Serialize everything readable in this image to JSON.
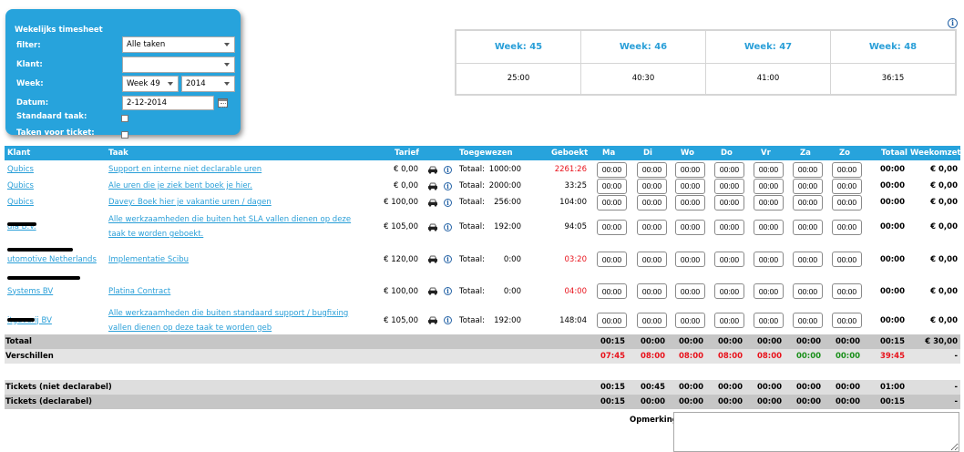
{
  "filter_panel": {
    "title": "Wekelijks timesheet",
    "filter_label": "filter:",
    "filter_value": "Alle taken",
    "klant_label": "Klant:",
    "klant_value": "",
    "week_label": "Week:",
    "week_value": "Week 49",
    "year_value": "2014",
    "datum_label": "Datum:",
    "datum_value": "2-12-2014",
    "standaard_label": "Standaard taak:",
    "tickets_label": "Taken voor ticket:"
  },
  "weeks": [
    {
      "label": "Week: 45",
      "value": "25:00"
    },
    {
      "label": "Week: 46",
      "value": "40:30"
    },
    {
      "label": "Week: 47",
      "value": "41:00"
    },
    {
      "label": "Week: 48",
      "value": "36:15"
    }
  ],
  "table": {
    "headers": {
      "klant": "Klant",
      "taak": "Taak",
      "tarief": "Tarief",
      "toegewezen": "Toegewezen",
      "geboekt": "Geboekt",
      "ma": "Ma",
      "di": "Di",
      "wo": "Wo",
      "do": "Do",
      "vr": "Vr",
      "za": "Za",
      "zo": "Zo",
      "totaal": "Totaal",
      "weekomzet": "Weekomzet"
    },
    "totaal_prefix": "Totaal:",
    "rows": [
      {
        "klant": "Qubics",
        "taak": "Support en interne niet declarable uren",
        "tarief": "€ 0,00",
        "toegewezen": "1000:00",
        "geboekt": "2261:26",
        "geboekt_status": "over",
        "days": [
          "00:00",
          "00:00",
          "00:00",
          "00:00",
          "00:00",
          "00:00",
          "00:00"
        ],
        "totaal": "00:00",
        "weekomzet": "€ 0,00"
      },
      {
        "klant": "Qubics",
        "taak": "Ale uren die je ziek bent boek je hier.",
        "tarief": "€ 0,00",
        "toegewezen": "2000:00",
        "geboekt": "33:25",
        "geboekt_status": "ok",
        "days": [
          "00:00",
          "00:00",
          "00:00",
          "00:00",
          "00:00",
          "00:00",
          "00:00"
        ],
        "totaal": "00:00",
        "weekomzet": "€ 0,00"
      },
      {
        "klant": "Qubics",
        "taak": "Davey: Boek hier je vakantie uren / dagen",
        "tarief": "€ 100,00",
        "toegewezen": "256:00",
        "geboekt": "104:00",
        "geboekt_status": "ok",
        "days": [
          "00:00",
          "00:00",
          "00:00",
          "00:00",
          "00:00",
          "00:00",
          "00:00"
        ],
        "totaal": "00:00",
        "weekomzet": "€ 0,00"
      },
      {
        "klant": "dia B.V.",
        "taak": "Alle werkzaamheden die buiten het SLA vallen dienen op deze taak te worden geboekt.",
        "tarief": "€ 105,00",
        "toegewezen": "192:00",
        "geboekt": "94:05",
        "geboekt_status": "ok",
        "days": [
          "00:00",
          "00:00",
          "00:00",
          "00:00",
          "00:00",
          "00:00",
          "00:00"
        ],
        "totaal": "00:00",
        "weekomzet": "€ 0,00"
      },
      {
        "klant": "utomotive Netherlands",
        "taak": "Implementatie Scibu",
        "tarief": "€ 120,00",
        "toegewezen": "0:00",
        "geboekt": "03:20",
        "geboekt_status": "over",
        "days": [
          "00:00",
          "00:00",
          "00:00",
          "00:00",
          "00:00",
          "00:00",
          "00:00"
        ],
        "totaal": "00:00",
        "weekomzet": "€ 0,00"
      },
      {
        "klant": "Systems BV",
        "taak": "Platina Contract",
        "tarief": "€ 100,00",
        "toegewezen": "0:00",
        "geboekt": "04:00",
        "geboekt_status": "over",
        "days": [
          "00:00",
          "00:00",
          "00:00",
          "00:00",
          "00:00",
          "00:00",
          "00:00"
        ],
        "totaal": "00:00",
        "weekomzet": "€ 0,00"
      },
      {
        "klant": "itgeverij BV",
        "taak": "Alle werkzaamheden die buiten standaard support / bugfixing vallen dienen op deze taak te worden geb",
        "tarief": "€ 105,00",
        "toegewezen": "192:00",
        "geboekt": "148:04",
        "geboekt_status": "ok",
        "days": [
          "00:00",
          "00:00",
          "00:00",
          "00:00",
          "00:00",
          "00:00",
          "00:00"
        ],
        "totaal": "00:00",
        "weekomzet": "€ 0,00"
      }
    ],
    "totaal_row": {
      "label": "Totaal",
      "days": [
        "00:15",
        "00:00",
        "00:00",
        "00:00",
        "00:00",
        "00:00",
        "00:00"
      ],
      "totaal": "00:15",
      "weekomzet": "€ 30,00"
    },
    "verschillen_row": {
      "label": "Verschillen",
      "days": [
        "07:45",
        "08:00",
        "08:00",
        "08:00",
        "08:00",
        "00:00",
        "00:00"
      ],
      "day_status": [
        "neg",
        "neg",
        "neg",
        "neg",
        "neg",
        "pos",
        "pos"
      ],
      "totaal": "39:45",
      "weekomzet": "-"
    },
    "tickets_niet": {
      "label": "Tickets (niet declarabel)",
      "days": [
        "00:15",
        "00:45",
        "00:00",
        "00:00",
        "00:00",
        "00:00",
        "00:00"
      ],
      "totaal": "01:00",
      "weekomzet": "-"
    },
    "tickets_decl": {
      "label": "Tickets (declarabel)",
      "days": [
        "00:15",
        "00:00",
        "00:00",
        "00:00",
        "00:00",
        "00:00",
        "00:00"
      ],
      "totaal": "00:15",
      "weekomzet": "-"
    }
  },
  "opmerking_label": "Opmerking:",
  "colors": {
    "accent": "#27a3dc",
    "link": "#2a9fd8",
    "over": "#e8121b",
    "positive": "#1a8f1a"
  }
}
